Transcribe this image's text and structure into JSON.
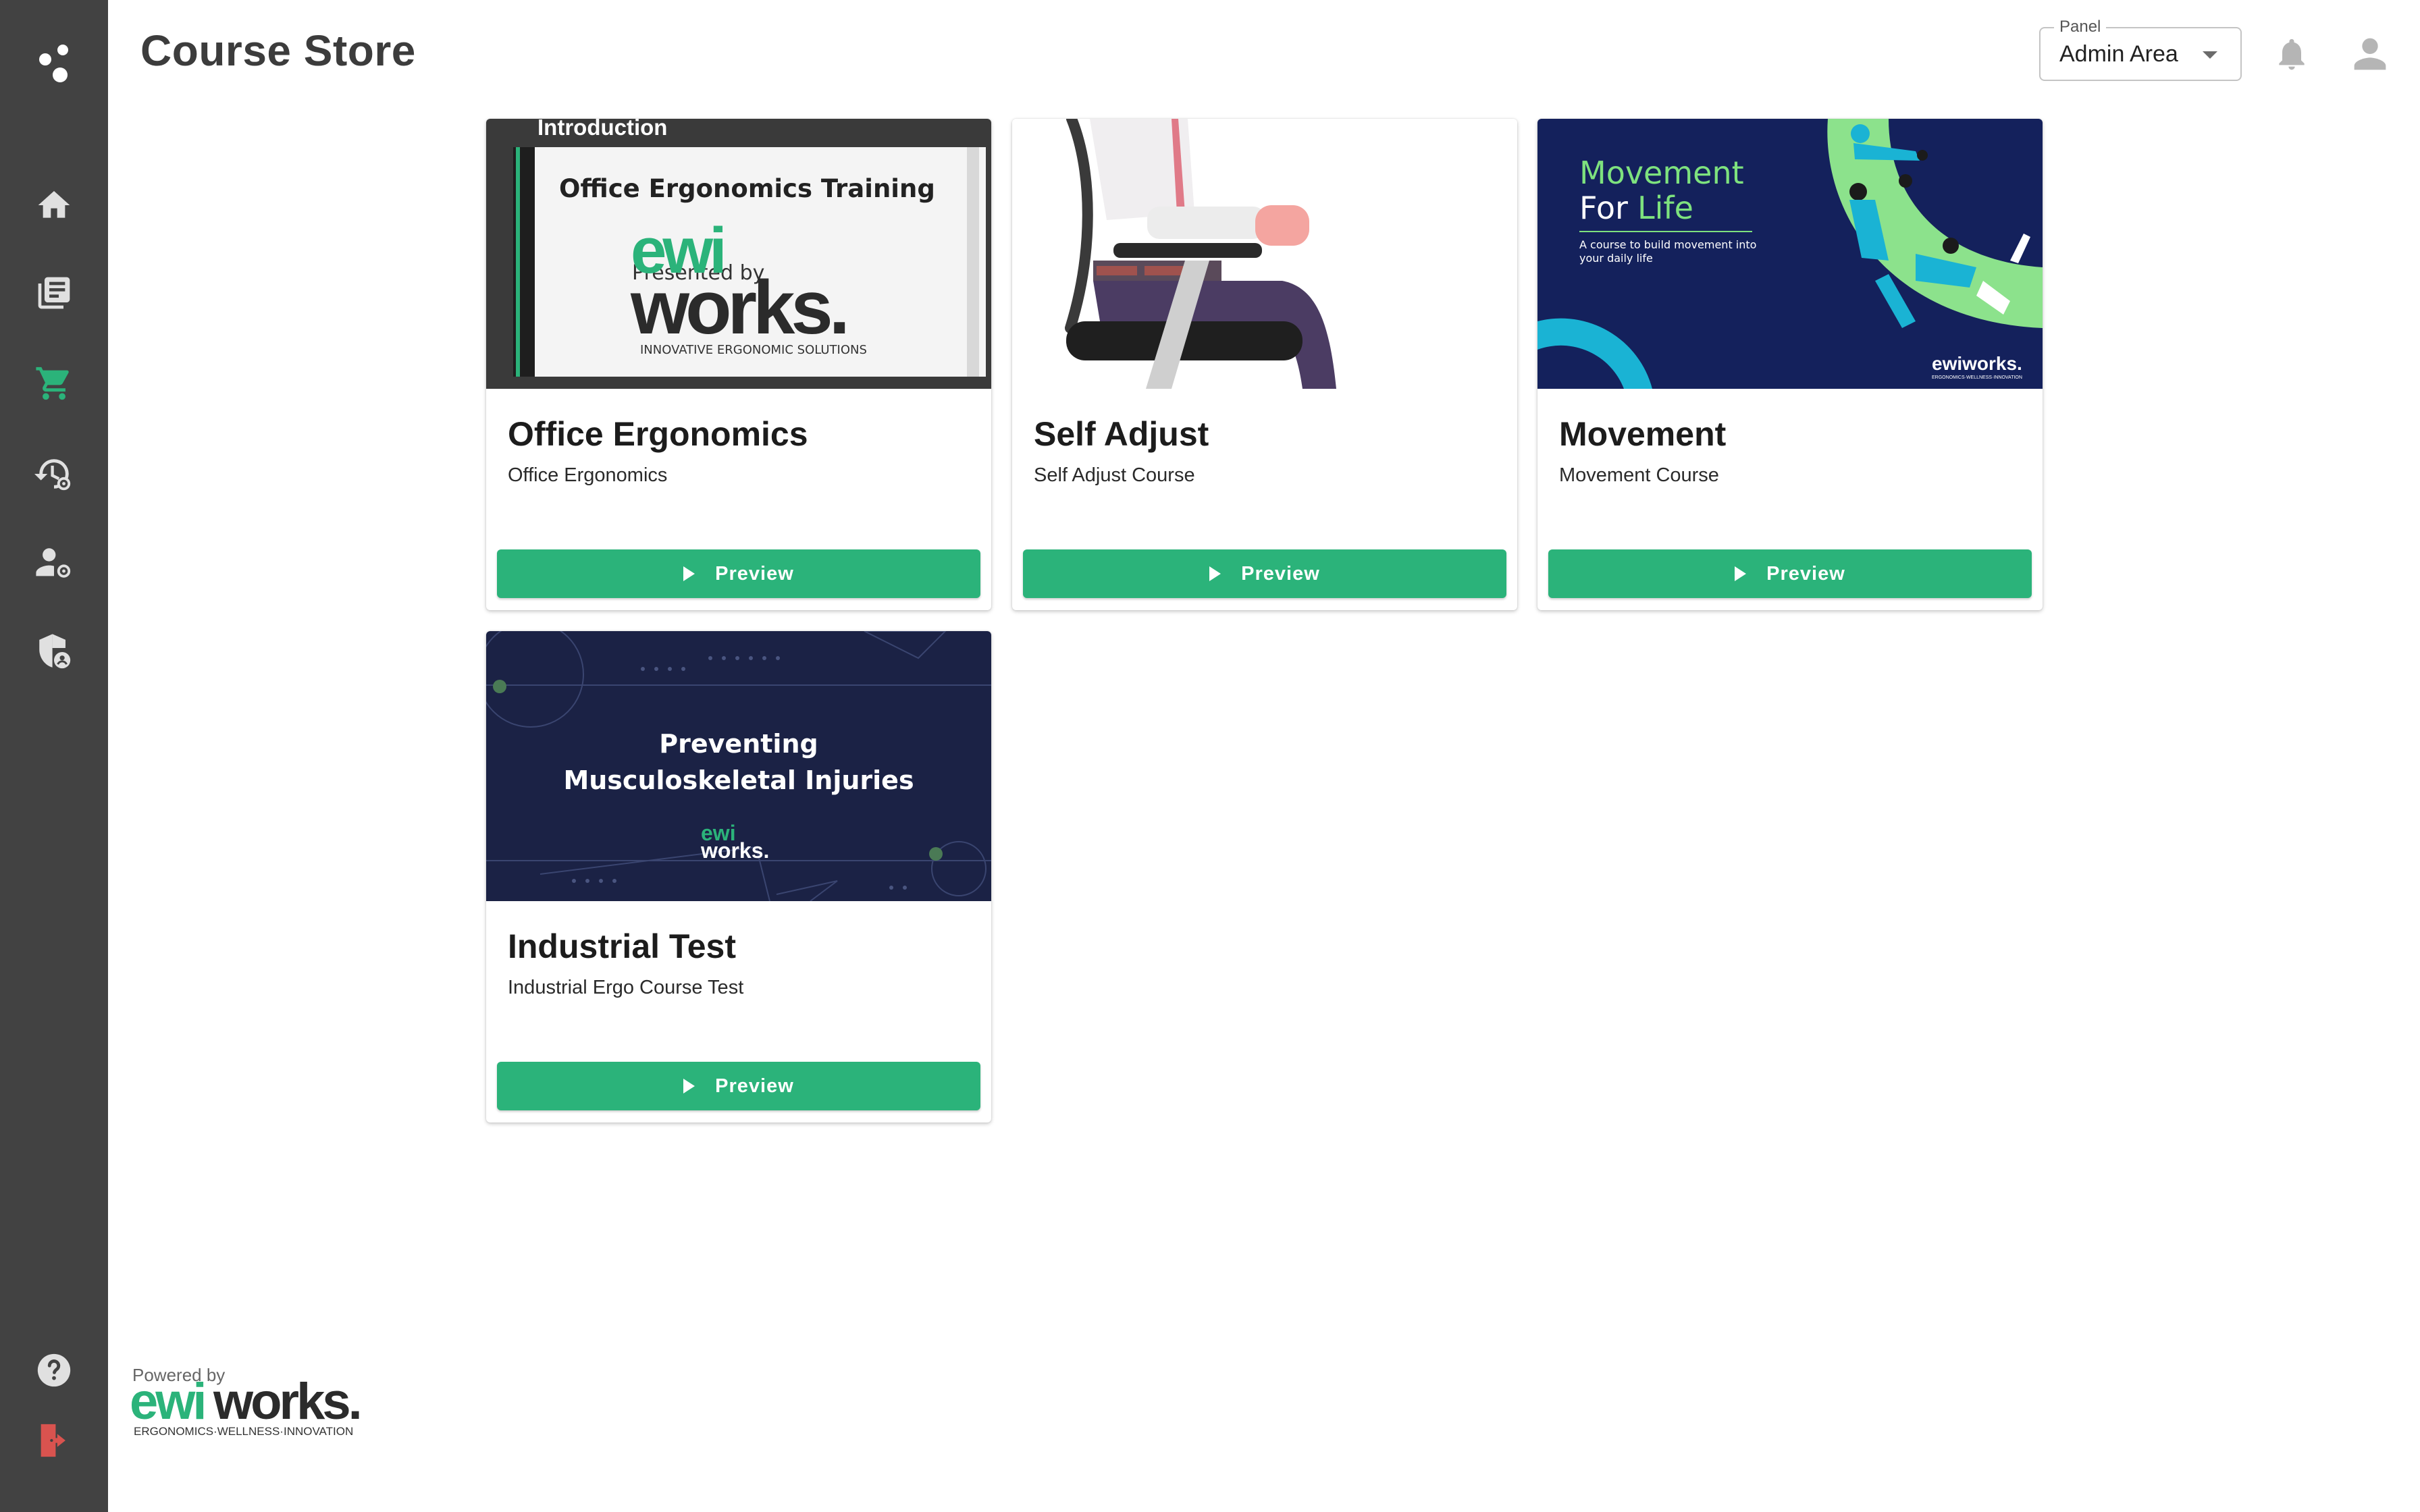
{
  "page": {
    "title": "Course Store"
  },
  "header": {
    "panel": {
      "label": "Panel",
      "value": "Admin Area"
    },
    "icons": [
      "bell-icon",
      "user-icon"
    ]
  },
  "sidebar": {
    "logo": "app-logo-icon",
    "items": [
      {
        "icon": "home-icon"
      },
      {
        "icon": "courses-icon"
      },
      {
        "icon": "cart-icon",
        "active": true
      },
      {
        "icon": "history-settings-icon"
      },
      {
        "icon": "user-settings-icon"
      },
      {
        "icon": "shield-user-icon"
      }
    ],
    "bottom": [
      {
        "icon": "help-icon"
      },
      {
        "icon": "logout-icon"
      }
    ]
  },
  "courses": [
    {
      "title": "Office Ergonomics",
      "subtitle": "Office Ergonomics",
      "button": "Preview",
      "thumb": {
        "heading": "Introduction",
        "title": "Office Ergonomics Training",
        "tagline": "INNOVATIVE ERGONOMIC SOLUTIONS",
        "brand_top": "ewi",
        "brand_bottom": "works.",
        "overlay": "Presented by"
      }
    },
    {
      "title": "Self Adjust",
      "subtitle": "Self Adjust Course",
      "button": "Preview"
    },
    {
      "title": "Movement",
      "subtitle": "Movement Course",
      "button": "Preview",
      "thumb": {
        "line1": "Movement",
        "line2a": "For ",
        "line2b": "Life",
        "desc1": "A course to build movement into",
        "desc2": "your daily life",
        "brand": "ewiworks.",
        "brand_sub": "ERGONOMICS·WELLNESS·INNOVATION"
      }
    },
    {
      "title": "Industrial Test",
      "subtitle": "Industrial Ergo Course Test",
      "button": "Preview",
      "thumb": {
        "line1": "Preventing",
        "line2": "Musculoskeletal Injuries",
        "brand_top": "ewi",
        "brand_bottom": "works."
      }
    }
  ],
  "footer": {
    "powered_by": "Powered by",
    "brand_green": "ewi",
    "brand_dark": "works.",
    "tagline": "ERGONOMICS·WELLNESS·INNOVATION"
  },
  "colors": {
    "sidebar": "#424242",
    "accent": "#2bb37a",
    "navy": "#14215c",
    "dark_navy": "#1b2245",
    "logout": "#d9534f"
  }
}
